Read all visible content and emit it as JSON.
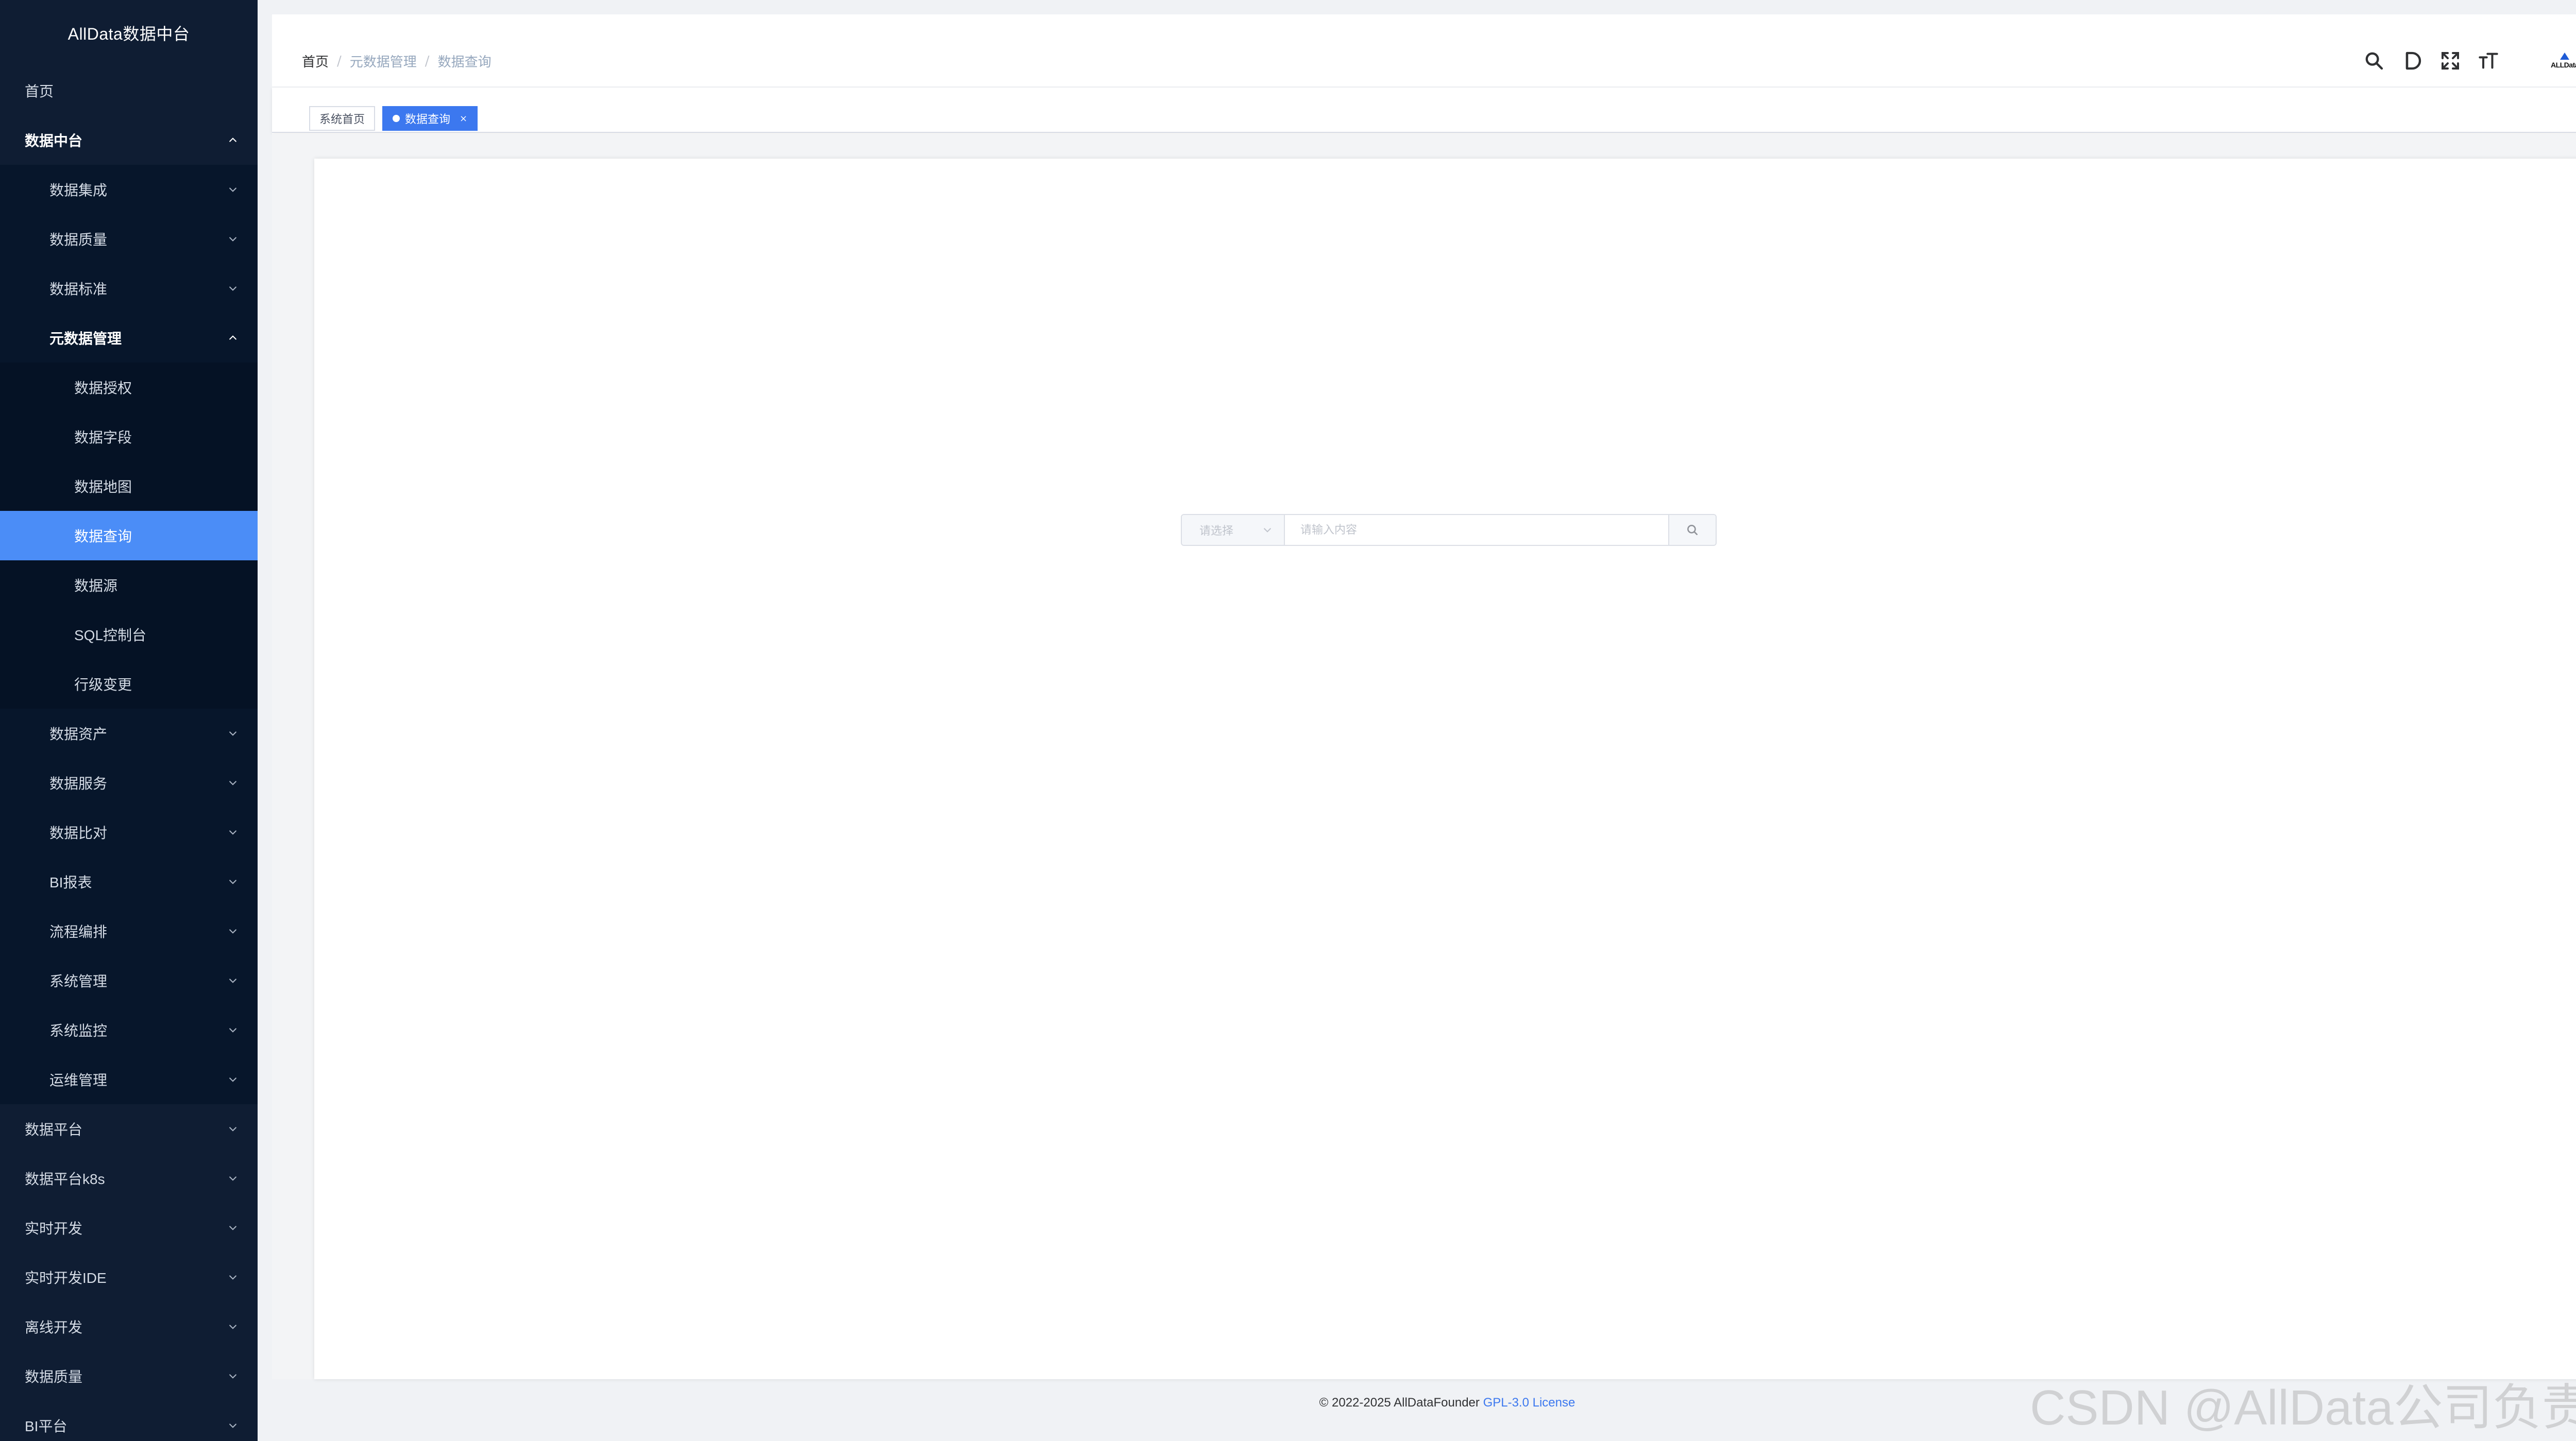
{
  "app": {
    "title": "AllData数据中台"
  },
  "sidebar": {
    "items": [
      {
        "label": "首页",
        "level": 1
      },
      {
        "label": "数据中台",
        "level": 1,
        "expanded": true
      },
      {
        "label": "数据集成",
        "level": 2
      },
      {
        "label": "数据质量",
        "level": 2
      },
      {
        "label": "数据标准",
        "level": 2
      },
      {
        "label": "元数据管理",
        "level": 2,
        "expanded": true
      },
      {
        "label": "数据授权",
        "level": 3
      },
      {
        "label": "数据字段",
        "level": 3
      },
      {
        "label": "数据地图",
        "level": 3
      },
      {
        "label": "数据查询",
        "level": 3,
        "active": true
      },
      {
        "label": "数据源",
        "level": 3
      },
      {
        "label": "SQL控制台",
        "level": 3
      },
      {
        "label": "行级变更",
        "level": 3
      },
      {
        "label": "数据资产",
        "level": 2
      },
      {
        "label": "数据服务",
        "level": 2
      },
      {
        "label": "数据比对",
        "level": 2
      },
      {
        "label": "BI报表",
        "level": 2
      },
      {
        "label": "流程编排",
        "level": 2
      },
      {
        "label": "系统管理",
        "level": 2
      },
      {
        "label": "系统监控",
        "level": 2
      },
      {
        "label": "运维管理",
        "level": 2
      },
      {
        "label": "数据平台",
        "level": 1
      },
      {
        "label": "数据平台k8s",
        "level": 1
      },
      {
        "label": "实时开发",
        "level": 1
      },
      {
        "label": "实时开发IDE",
        "level": 1
      },
      {
        "label": "离线开发",
        "level": 1
      },
      {
        "label": "数据质量",
        "level": 1
      },
      {
        "label": "BI平台",
        "level": 1
      }
    ]
  },
  "breadcrumb": {
    "home": "首页",
    "sep": "/",
    "level1": "元数据管理",
    "level2": "数据查询"
  },
  "navbar": {
    "avatar_text": "ALLData"
  },
  "tags": {
    "home": "系统首页",
    "current": "数据查询",
    "close": "×"
  },
  "search": {
    "select_placeholder": "请选择",
    "input_placeholder": "请输入内容"
  },
  "footer": {
    "copyright": "© 2022-2025 AllDataFounder ",
    "license_link": "GPL-3.0 License"
  },
  "watermark": "CSDN @AllData公司负责人",
  "colors": {
    "sidebar_bg": "#0f1d33",
    "active_item": "#4b8df7",
    "accent": "#3c78ef"
  }
}
